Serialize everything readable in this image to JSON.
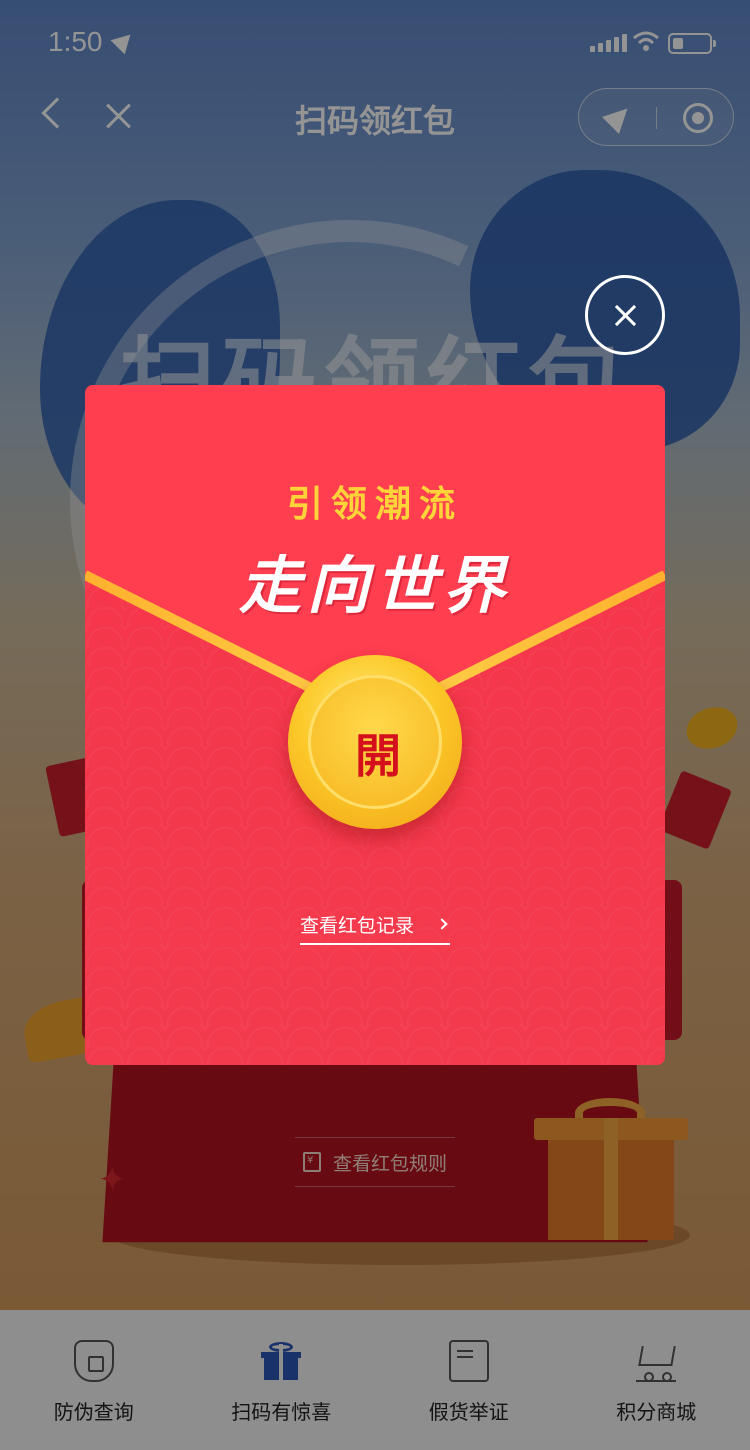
{
  "status_bar": {
    "time": "1:50"
  },
  "nav": {
    "title": "扫码领红包"
  },
  "background": {
    "title_art": "扫码领红包"
  },
  "rules_link": {
    "label": "查看红包规则"
  },
  "modal": {
    "slogan": "引领潮流",
    "headline": "走向世界",
    "open_char": "開",
    "record_link": "查看红包记录"
  },
  "tabbar": {
    "items": [
      {
        "label": "防伪查询",
        "icon": "shield-lock-icon"
      },
      {
        "label": "扫码有惊喜",
        "icon": "gift-icon"
      },
      {
        "label": "假货举证",
        "icon": "report-chat-icon"
      },
      {
        "label": "积分商城",
        "icon": "cart-icon"
      }
    ]
  },
  "colors": {
    "packet_red": "#f8364a",
    "slogan_gold": "#ffd438",
    "coin_gold": "#fcc92a",
    "tab_active": "#2b56b6"
  }
}
